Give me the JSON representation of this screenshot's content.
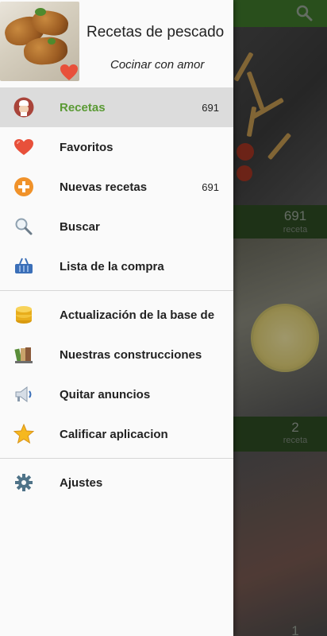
{
  "header": {
    "title": "Recetas de pescado",
    "subtitle": "Cocinar con amor"
  },
  "menu_group_1": [
    {
      "id": "recetas",
      "label": "Recetas",
      "count": "691",
      "icon": "chef-icon",
      "active": true
    },
    {
      "id": "favoritos",
      "label": "Favoritos",
      "count": "",
      "icon": "heart-icon",
      "active": false
    },
    {
      "id": "nuevas-recetas",
      "label": "Nuevas recetas",
      "count": "691",
      "icon": "plus-circle-icon",
      "active": false
    },
    {
      "id": "buscar",
      "label": "Buscar",
      "count": "",
      "icon": "search-icon",
      "active": false
    },
    {
      "id": "lista-compra",
      "label": "Lista de la compra",
      "count": "",
      "icon": "basket-icon",
      "active": false
    }
  ],
  "menu_group_2": [
    {
      "id": "actualizacion",
      "label": "Actualización de la base de",
      "icon": "database-icon"
    },
    {
      "id": "construcciones",
      "label": "Nuestras construcciones",
      "icon": "books-icon"
    },
    {
      "id": "quitar-anuncios",
      "label": "Quitar anuncios",
      "icon": "megaphone-icon"
    },
    {
      "id": "calificar",
      "label": "Calificar aplicacion",
      "icon": "star-icon"
    }
  ],
  "menu_group_3": [
    {
      "id": "ajustes",
      "label": "Ajustes",
      "icon": "gear-icon"
    }
  ],
  "background": {
    "card1_count": "691",
    "card1_sub": "receta",
    "card2_count": "2",
    "card2_sub": "receta",
    "card3_count": "1"
  },
  "colors": {
    "accent": "#5a9a34",
    "topbar": "#3f7a2c",
    "active_bg": "#dcdcdc"
  }
}
